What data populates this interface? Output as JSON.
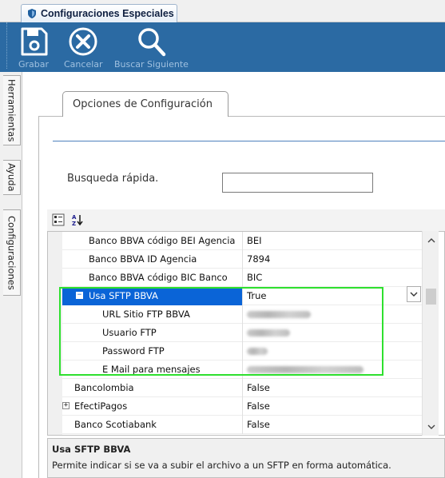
{
  "document_tab": {
    "title": "Configuraciones Especiales"
  },
  "toolbar": {
    "save_label": "Grabar",
    "cancel_label": "Cancelar",
    "search_next_label": "Buscar Siguiente"
  },
  "side_tabs": [
    "Herramientas",
    "Ayuda",
    "Configuraciones"
  ],
  "options_tab": {
    "label": "Opciones de Configuración"
  },
  "quick_search": {
    "label": "Busqueda rápida.",
    "value": ""
  },
  "property_grid": {
    "rows": [
      {
        "name": "Banco BBVA código BEI Agencia",
        "value": "BEI"
      },
      {
        "name": "Banco BBVA ID Agencia",
        "value": "7894"
      },
      {
        "name": "Banco BBVA código BIC Banco",
        "value": "BIC"
      },
      {
        "name": "Usa SFTP BBVA",
        "value": "True",
        "expanded": true,
        "selected": true
      },
      {
        "name": "URL Sitio FTP BBVA",
        "value": "redacted"
      },
      {
        "name": "Usuario FTP",
        "value": "redacted"
      },
      {
        "name": "Password FTP",
        "value": "redacted"
      },
      {
        "name": "E Mail para mensajes",
        "value": "redacted"
      },
      {
        "name": "Bancolombia",
        "value": "False"
      },
      {
        "name": "EfectiPagos",
        "value": "False",
        "expandable": true
      },
      {
        "name": "Banco Scotiabank",
        "value": "False"
      }
    ]
  },
  "description": {
    "title": "Usa SFTP BBVA",
    "text": "Permite indicar si se va a subir el archivo a un SFTP en forma automática."
  },
  "colors": {
    "toolbar_bg": "#2b6aa3",
    "selection": "#0a64d7",
    "highlight_box": "#2ee02e"
  }
}
